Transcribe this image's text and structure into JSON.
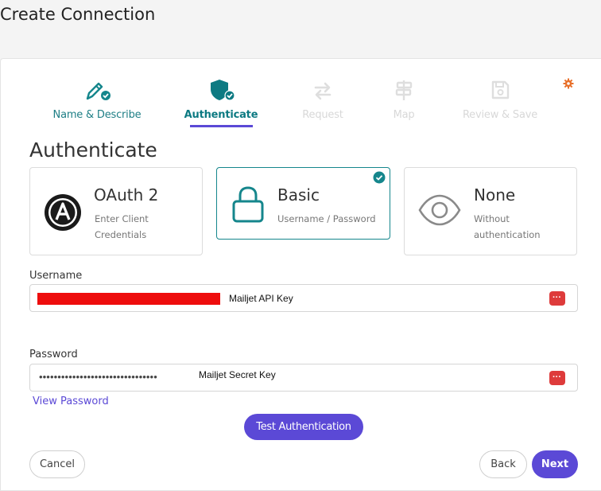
{
  "page": {
    "title": "Create Connection"
  },
  "steps": [
    {
      "label": "Name & Describe",
      "icon": "pencil-check-icon",
      "state": "done"
    },
    {
      "label": "Authenticate",
      "icon": "shield-check-icon",
      "state": "active"
    },
    {
      "label": "Request",
      "icon": "swap-arrows-icon",
      "state": "todo"
    },
    {
      "label": "Map",
      "icon": "signpost-icon",
      "state": "todo"
    },
    {
      "label": "Review & Save",
      "icon": "save-icon",
      "state": "todo"
    }
  ],
  "section": {
    "title": "Authenticate"
  },
  "auth_options": [
    {
      "name": "OAuth 2",
      "desc": "Enter Client Credentials",
      "icon": "oauth-logo-icon",
      "selected": false
    },
    {
      "name": "Basic",
      "desc": "Username / Password",
      "icon": "padlock-icon",
      "selected": true
    },
    {
      "name": "None",
      "desc": "Without authentication",
      "icon": "eye-icon",
      "selected": false
    }
  ],
  "username": {
    "label": "Username",
    "note": "Mailjet API Key"
  },
  "password": {
    "label": "Password",
    "masked": "••••••••••••••••••••••••••••••••",
    "note": "Mailjet Secret Key",
    "view_link": "View Password"
  },
  "buttons": {
    "test": "Test Authentication",
    "cancel": "Cancel",
    "back": "Back",
    "next": "Next"
  },
  "colors": {
    "accent": "#5b49d6",
    "teal": "#15868c",
    "key_button": "#de3b3b",
    "gear": "#e8702a"
  }
}
